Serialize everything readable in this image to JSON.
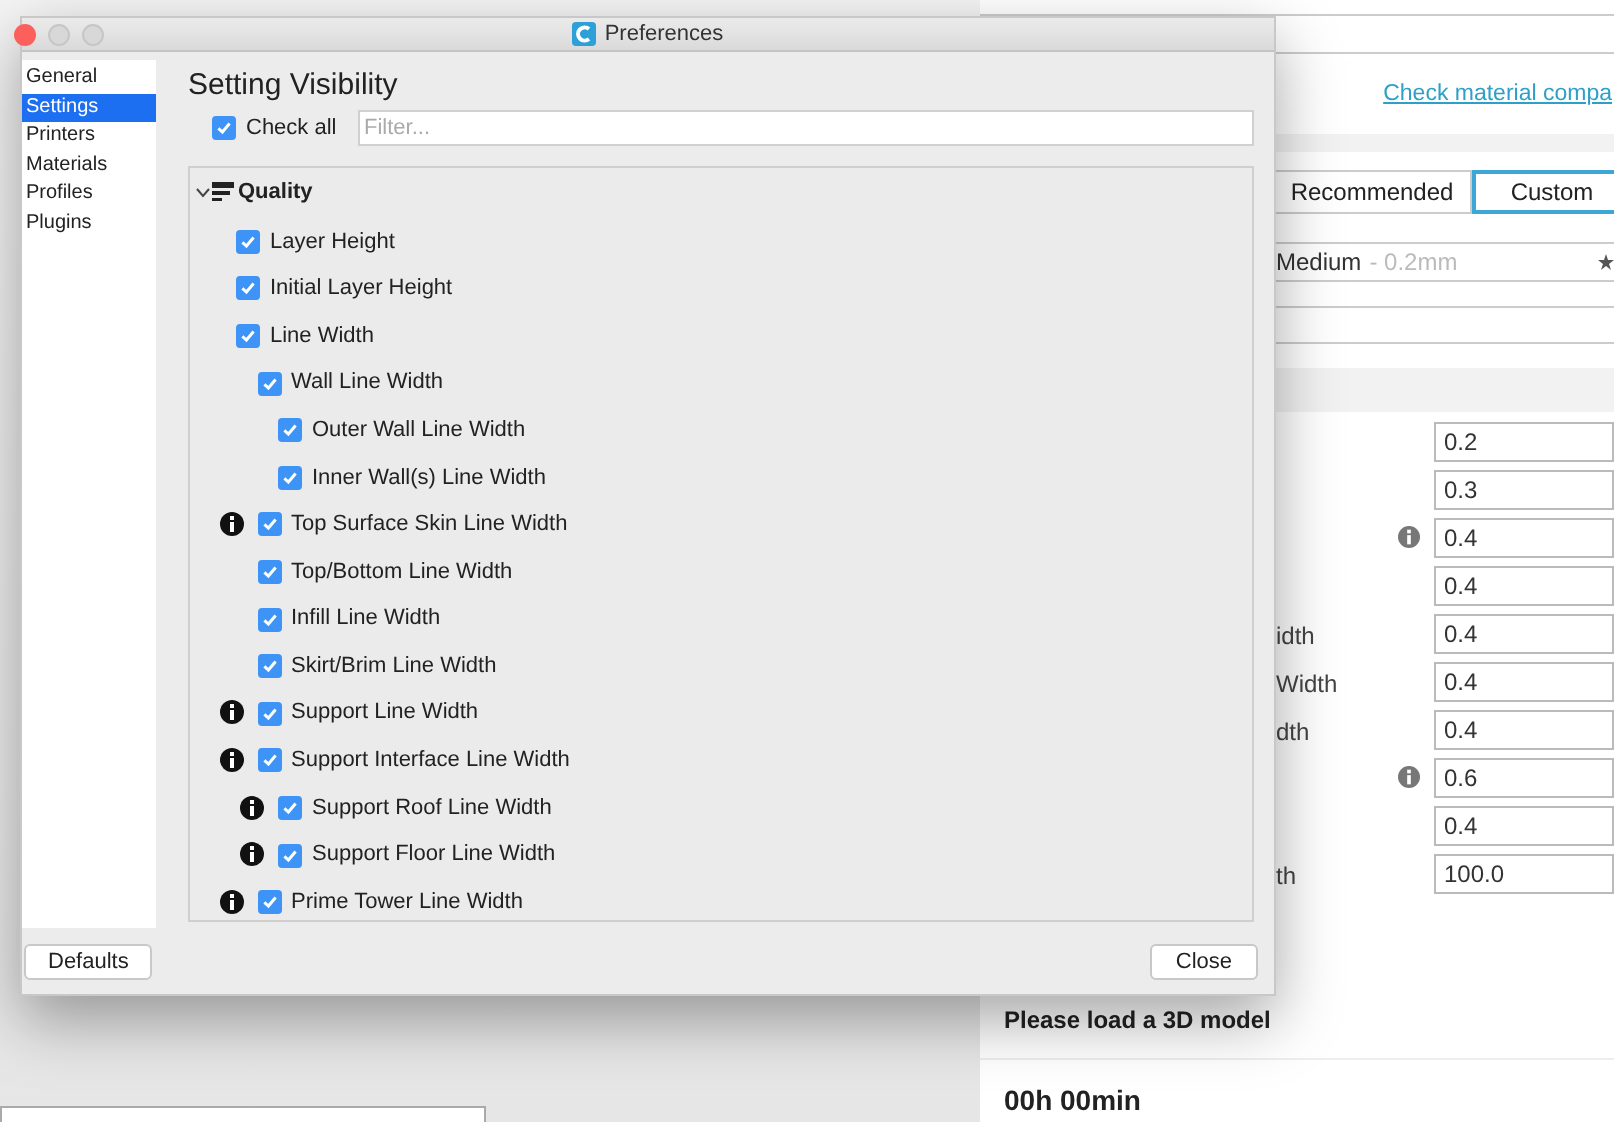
{
  "window": {
    "title": "Preferences"
  },
  "sidebar": {
    "items": [
      {
        "label": "General",
        "selected": false
      },
      {
        "label": "Settings",
        "selected": true
      },
      {
        "label": "Printers",
        "selected": false
      },
      {
        "label": "Materials",
        "selected": false
      },
      {
        "label": "Profiles",
        "selected": false
      },
      {
        "label": "Plugins",
        "selected": false
      }
    ]
  },
  "heading": "Setting Visibility",
  "check_all": {
    "label": "Check all",
    "checked": true
  },
  "filter": {
    "placeholder": "Filter..."
  },
  "category": {
    "label": "Quality",
    "expanded": true,
    "children": [
      {
        "label": "Layer Height",
        "checked": true,
        "info": false
      },
      {
        "label": "Initial Layer Height",
        "checked": true,
        "info": false
      },
      {
        "label": "Line Width",
        "checked": true,
        "info": false,
        "children": [
          {
            "label": "Wall Line Width",
            "checked": true,
            "info": false,
            "children": [
              {
                "label": "Outer Wall Line Width",
                "checked": true,
                "info": false
              },
              {
                "label": "Inner Wall(s) Line Width",
                "checked": true,
                "info": false
              }
            ]
          },
          {
            "label": "Top Surface Skin Line Width",
            "checked": true,
            "info": true
          },
          {
            "label": "Top/Bottom Line Width",
            "checked": true,
            "info": false
          },
          {
            "label": "Infill Line Width",
            "checked": true,
            "info": false
          },
          {
            "label": "Skirt/Brim Line Width",
            "checked": true,
            "info": false
          },
          {
            "label": "Support Line Width",
            "checked": true,
            "info": true
          },
          {
            "label": "Support Interface Line Width",
            "checked": true,
            "info": true,
            "children": [
              {
                "label": "Support Roof Line Width",
                "checked": true,
                "info": true
              },
              {
                "label": "Support Floor Line Width",
                "checked": true,
                "info": true
              }
            ]
          },
          {
            "label": "Prime Tower Line Width",
            "checked": true,
            "info": true
          }
        ]
      }
    ]
  },
  "buttons": {
    "defaults": "Defaults",
    "close": "Close"
  },
  "background": {
    "link": "Check material compa",
    "tabs": [
      {
        "label": "Recommended",
        "selected": false
      },
      {
        "label": "Custom",
        "selected": true
      }
    ],
    "profile": {
      "name": "Medium",
      "detail": "- 0.2mm"
    },
    "fields": [
      {
        "info": false,
        "value": "0.2"
      },
      {
        "info": false,
        "value": "0.3"
      },
      {
        "info": true,
        "value": "0.4"
      },
      {
        "info": false,
        "value": "0.4"
      },
      {
        "label": "idth",
        "info": false,
        "value": "0.4"
      },
      {
        "label": "Width",
        "info": false,
        "value": "0.4"
      },
      {
        "label": "dth",
        "info": false,
        "value": "0.4"
      },
      {
        "info": true,
        "value": "0.6"
      },
      {
        "info": false,
        "value": "0.4"
      },
      {
        "label": "th",
        "info": false,
        "value": "100.0"
      }
    ],
    "status": "Please load a 3D model",
    "time": "00h 00min"
  }
}
